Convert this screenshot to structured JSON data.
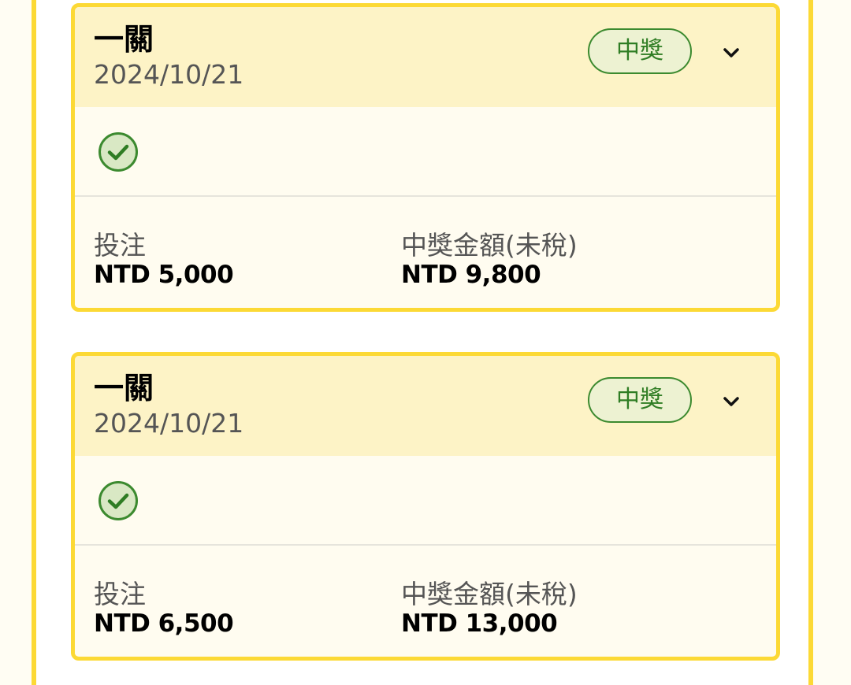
{
  "cards": [
    {
      "title": "一關",
      "date": "2024/10/21",
      "status": "中獎",
      "bet_label": "投注",
      "bet_value": "NTD 5,000",
      "payout_label": "中獎金額(未稅)",
      "payout_value": "NTD 9,800"
    },
    {
      "title": "一關",
      "date": "2024/10/21",
      "status": "中獎",
      "bet_label": "投注",
      "bet_value": "NTD 6,500",
      "payout_label": "中獎金額(未稅)",
      "payout_value": "NTD 13,000"
    }
  ],
  "colors": {
    "accent_border": "#fcd935",
    "header_bg": "#fdf3c6",
    "win_green": "#3c8a2f",
    "badge_bg": "#edf2d2"
  },
  "icons": {
    "check": "check-circle-icon",
    "expand": "chevron-down-icon"
  }
}
